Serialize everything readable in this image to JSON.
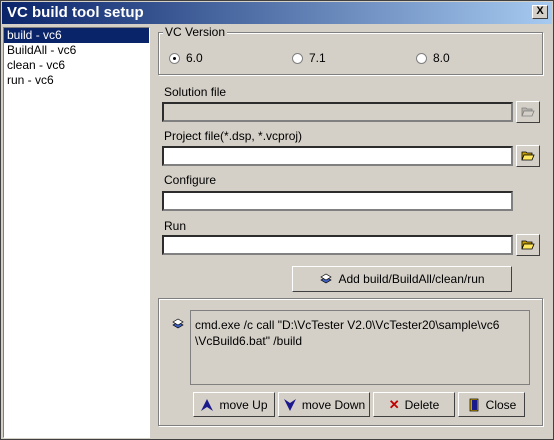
{
  "window": {
    "title": "VC build tool setup",
    "close_label": "X"
  },
  "list": {
    "items": [
      "build - vc6",
      "BuildAll - vc6",
      "clean - vc6",
      "run - vc6"
    ],
    "selected": 0
  },
  "vc_version": {
    "label": "VC Version",
    "options": [
      "6.0",
      "7.1",
      "8.0"
    ],
    "selected": "6.0"
  },
  "solution": {
    "label": "Solution file",
    "value": ""
  },
  "project": {
    "label": "Project file(*.dsp, *.vcproj)",
    "value": ""
  },
  "configure": {
    "label": "Configure",
    "value": ""
  },
  "run": {
    "label": "Run",
    "value": ""
  },
  "add_button": {
    "label": "Add build/BuildAll/clean/run"
  },
  "command": {
    "line1": "cmd.exe /c call \"D:\\VcTester V2.0\\VcTester20\\sample\\vc6",
    "line2": "\\VcBuild6.bat\" /build"
  },
  "buttons": {
    "move_up": "move Up",
    "move_down": "move Down",
    "delete": "Delete",
    "close": "Close"
  },
  "colors": {
    "titlebar": "#0a246a",
    "selection": "#0a246a",
    "face": "#d4d0c8",
    "delete_x": "#c00000",
    "arrow": "#1a1a8c"
  }
}
